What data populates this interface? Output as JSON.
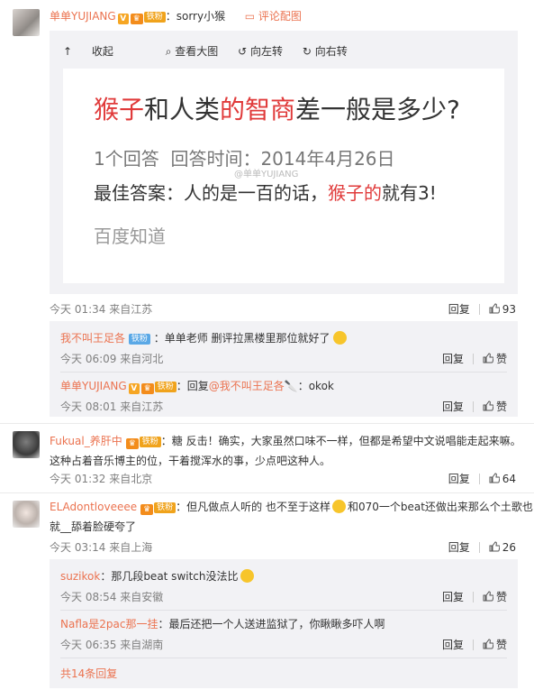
{
  "post": {
    "author": "单单YUJIANG",
    "separator": "：",
    "text": "sorry小猴",
    "pic_comment_link": "评论配图"
  },
  "viewer": {
    "toolbar": {
      "collapse": "收起",
      "large": "查看大图",
      "rotate_left": "向左转",
      "rotate_right": "向右转"
    },
    "image": {
      "question_part1": "猴子",
      "question_part2": "和人类",
      "question_part3": "的智商",
      "question_part4": "差一般是多少?",
      "answer_count": "1个回答",
      "answer_time": "回答时间：2014年4月26日",
      "best_part1": "最佳答案：人的是一百的话，",
      "best_part2": "猴子的",
      "best_part3": "就有3!",
      "source": "百度知道",
      "watermark": "@单单YUJIANG"
    }
  },
  "badges": {
    "tiefen": "铁粉",
    "v": "V"
  },
  "comments": [
    {
      "time": "今天 01:34 来自江苏",
      "reply": "回复",
      "likes": "93",
      "subreplies": [
        {
          "author": "我不叫王足各",
          "text": "单单老师 删评拉黑楼里那位就好了",
          "time": "今天 06:09 来自河北",
          "reply": "回复",
          "like": "赞"
        },
        {
          "author": "单单YUJIANG",
          "text_prefix": "回复",
          "mention": "@我不叫王足各",
          "text_suffix": "：okok",
          "time": "今天 08:01 来自江苏",
          "reply": "回复",
          "like": "赞"
        }
      ]
    },
    {
      "author": "Fukual_养肝中",
      "text_line1": "：糖 反击！确实，大家虽然口味不一样，但都是希望中文说唱能走起来嘛。",
      "text_line2": "这种占着音乐博主的位，干着搅浑水的事，少点吧这种人。",
      "time": "今天 01:32 来自北京",
      "reply": "回复",
      "likes": "64"
    },
    {
      "author": "ELAdontloveeee",
      "text_line1a": "：但凡做点人听的 也不至于这样",
      "text_line1b": "和070一个beat还做出来那么个土歌也",
      "text_line2": "就__舔着脸硬夸了",
      "time": "今天 03:14 来自上海",
      "reply": "回复",
      "likes": "26",
      "subreplies": [
        {
          "author": "suzikok",
          "text": "：那几段beat switch没法比",
          "time": "今天 08:54 来自安徽",
          "reply": "回复",
          "like": "赞"
        },
        {
          "author": "Nafla是2pac那一挂",
          "text": "：最后还把一个人送进监狱了，你瞅瞅多吓人啊",
          "time": "今天 06:35 来自湖南",
          "reply": "回复",
          "like": "赞"
        }
      ],
      "more": "共14条回复"
    }
  ],
  "colors": {
    "link": "#eb7350",
    "red_text": "#e03a3a",
    "meta": "#808080",
    "subbox_bg": "#f2f2f5"
  }
}
